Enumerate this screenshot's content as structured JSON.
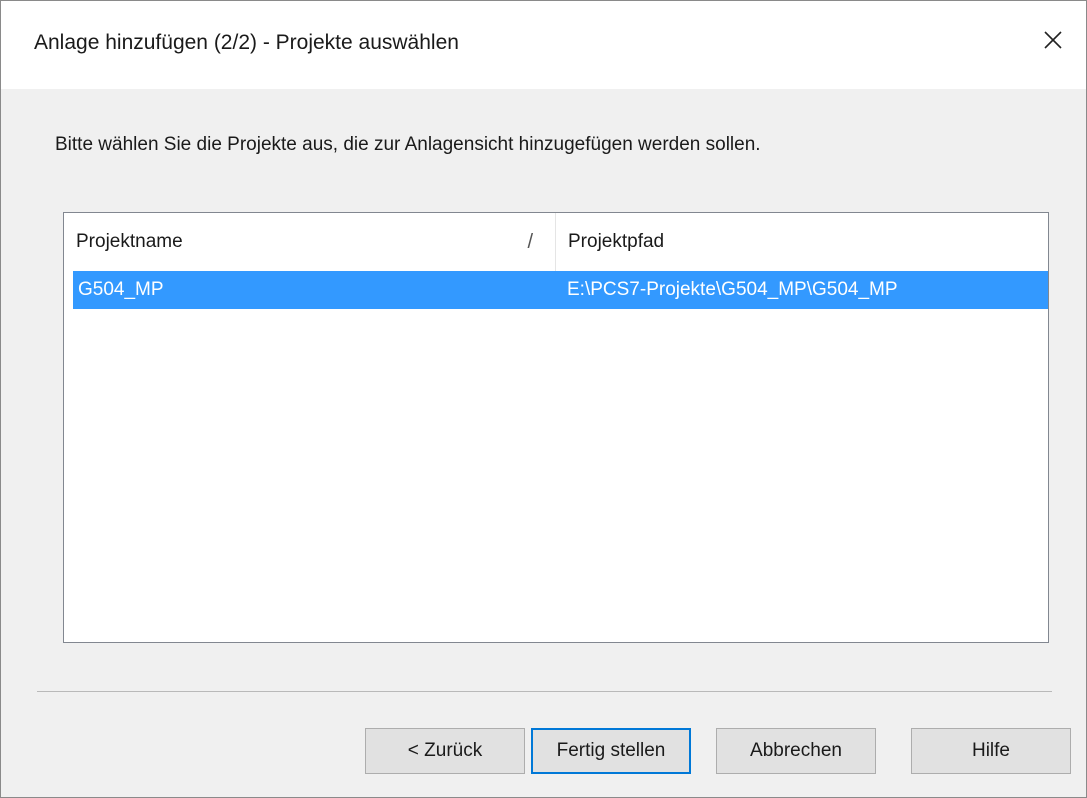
{
  "window": {
    "title": "Anlage hinzufügen (2/2) - Projekte auswählen",
    "close_icon": "close-icon"
  },
  "instruction": "Bitte wählen Sie die Projekte aus, die zur Anlagensicht hinzugefügen werden sollen.",
  "table": {
    "columns": [
      {
        "label": "Projektname",
        "sort_indicator": "/"
      },
      {
        "label": "Projektpfad"
      }
    ],
    "rows": [
      {
        "name": "G504_MP",
        "path": "E:\\PCS7-Projekte\\G504_MP\\G504_MP",
        "selected": true
      }
    ]
  },
  "buttons": {
    "back": "< Zurück",
    "finish": "Fertig stellen",
    "cancel": "Abbrechen",
    "help": "Hilfe"
  },
  "colors": {
    "selection": "#3399ff",
    "default_button_border": "#0078d7"
  }
}
